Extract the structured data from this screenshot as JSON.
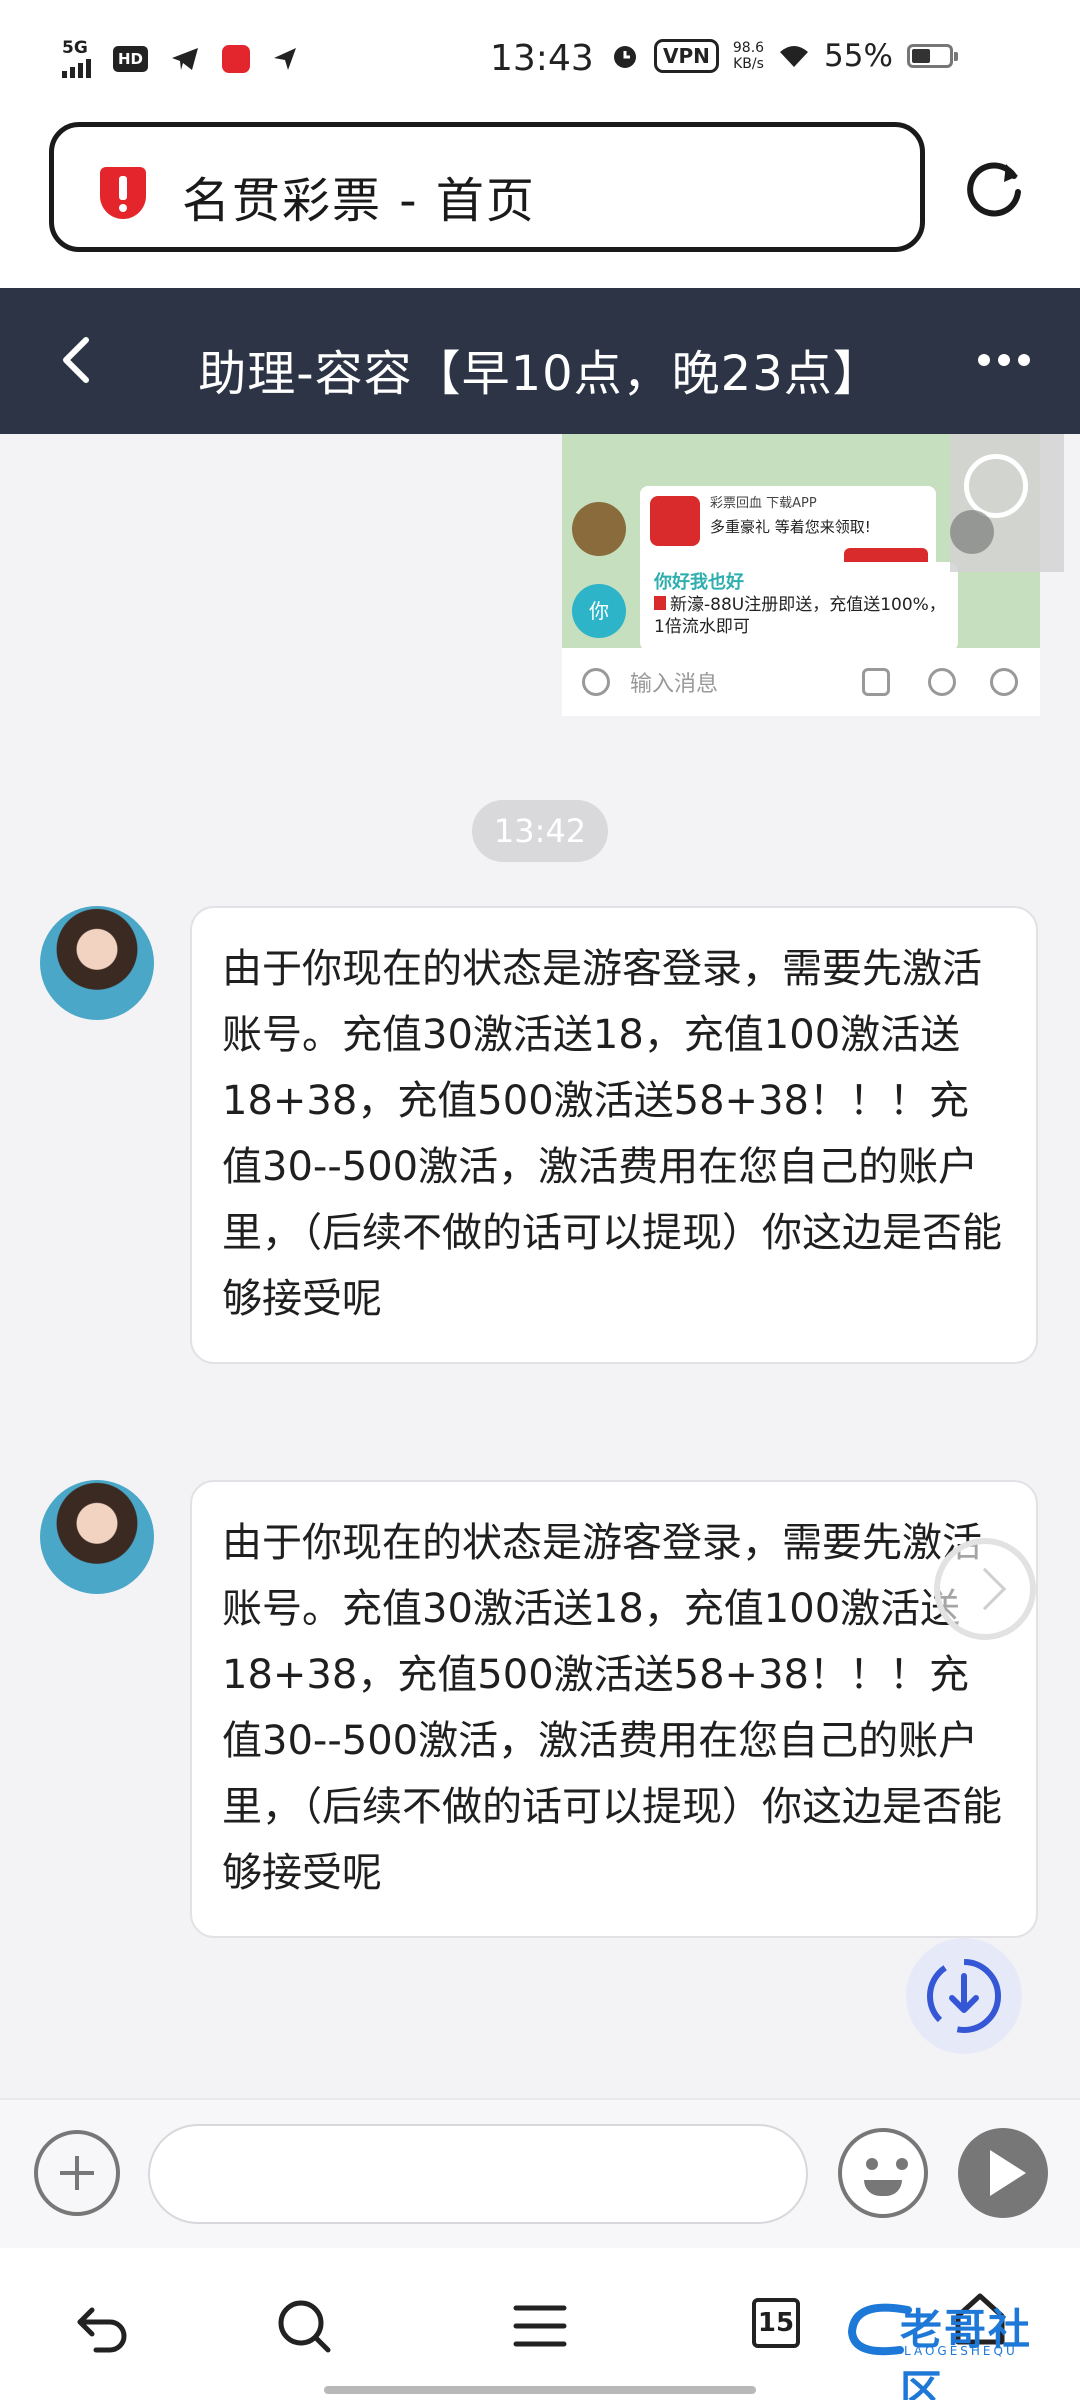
{
  "status_bar": {
    "network": "5G",
    "hd": "HD",
    "time": "13:43",
    "vpn": "VPN",
    "speed_value": "98.6",
    "speed_unit": "KB/s",
    "battery": "55%"
  },
  "browser": {
    "page_title": "名贯彩票 - 首页"
  },
  "chat_header": {
    "title": "助理-容容【早10点，晚23点】"
  },
  "image_message": {
    "promo_top": "彩票回血 下载APP",
    "promo_line": "多重豪礼 等着您来领取!",
    "you_label": "你",
    "bubble_title": "你好我也好",
    "bubble_text": "新濠-88U注册即送，充值送100%，1倍流水即可",
    "input_placeholder": "输入消息"
  },
  "timestamp": "13:42",
  "messages": [
    {
      "text": "由于你现在的状态是游客登录，需要先激活账号。充值30激活送18，充值100激活送18+38，充值500激活送58+38！！！充值30--500激活，激活费用在您自己的账户里，（后续不做的话可以提现）你这边是否能够接受呢"
    },
    {
      "text": "由于你现在的状态是游客登录，需要先激活账号。充值30激活送18，充值100激活送18+38，充值500激活送58+38！！！充值30--500激活，激活费用在您自己的账户里，（后续不做的话可以提现）你这边是否能够接受呢"
    }
  ],
  "input_bar": {
    "value": "",
    "placeholder": ""
  },
  "bottom_nav": {
    "tab_count": "15",
    "watermark": "老哥社区",
    "watermark_sub": "LAOGESHEQU"
  },
  "colors": {
    "header_bg": "#2d3446",
    "shield_red": "#e4262c",
    "bubble_bg": "#ffffff",
    "page_bg": "#f3f3f5",
    "watermark_blue": "#1e78d7"
  },
  "icons": [
    "signal-icon",
    "telegram-icon",
    "shield-icon",
    "reload-icon",
    "back-icon",
    "more-icon",
    "plus-icon",
    "emoji-icon",
    "send-icon",
    "undo-icon",
    "search-icon",
    "menu-icon",
    "home-icon",
    "download-icon",
    "collapse-icon"
  ]
}
